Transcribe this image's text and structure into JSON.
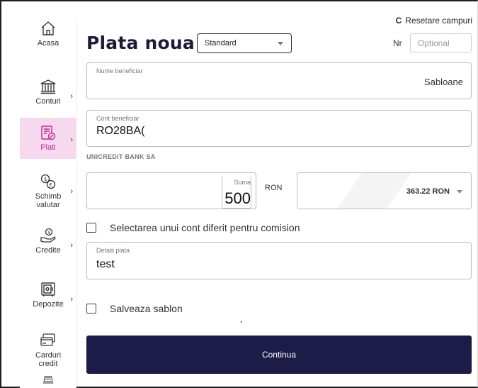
{
  "sidebar": {
    "items": [
      {
        "label": "Acasa",
        "icon": "home-icon",
        "has_arrow": false,
        "active": false
      },
      {
        "label": "Conturi",
        "icon": "bank-icon",
        "has_arrow": true,
        "active": false
      },
      {
        "label": "Plati",
        "icon": "payment-icon",
        "has_arrow": true,
        "active": true
      },
      {
        "label": "Schimb\nvalutar",
        "icon": "currency-exchange-icon",
        "has_arrow": true,
        "active": false
      },
      {
        "label": "Credite",
        "icon": "credit-hand-icon",
        "has_arrow": true,
        "active": false
      },
      {
        "label": "Depozite",
        "icon": "safe-icon",
        "has_arrow": true,
        "active": false
      },
      {
        "label": "Carduri\ncredit",
        "icon": "card-icon",
        "has_arrow": false,
        "active": false
      },
      {
        "label": "",
        "icon": "laptop-icon",
        "has_arrow": false,
        "active": false
      }
    ]
  },
  "header": {
    "reset_label": "Resetare campuri",
    "title": "Plata noua",
    "type_select": "Standard",
    "nr_label": "Nr",
    "nr_placeholder": "Optional"
  },
  "form": {
    "beneficiary_label": "Nume beneficiar",
    "beneficiary_value": "",
    "templates_label": "Sabloane",
    "account_label": "Cont beneficiar",
    "account_value": "RO28BA(",
    "bank_name": "UNICREDIT BANK SA",
    "amount_label": "Suma",
    "amount_value": "500",
    "currency": "RON",
    "source_balance": "363.22 RON",
    "commission_checkbox_label": "Selectarea unui cont diferit pentru comision",
    "details_label": "Detalii plata",
    "details_value": "test",
    "save_template_label": "Salveaza sablon",
    "continue_label": "Continua"
  },
  "colors": {
    "primary": "#1d1b47",
    "active_bg": "#f6d9ef",
    "active_text": "#c0268f"
  }
}
